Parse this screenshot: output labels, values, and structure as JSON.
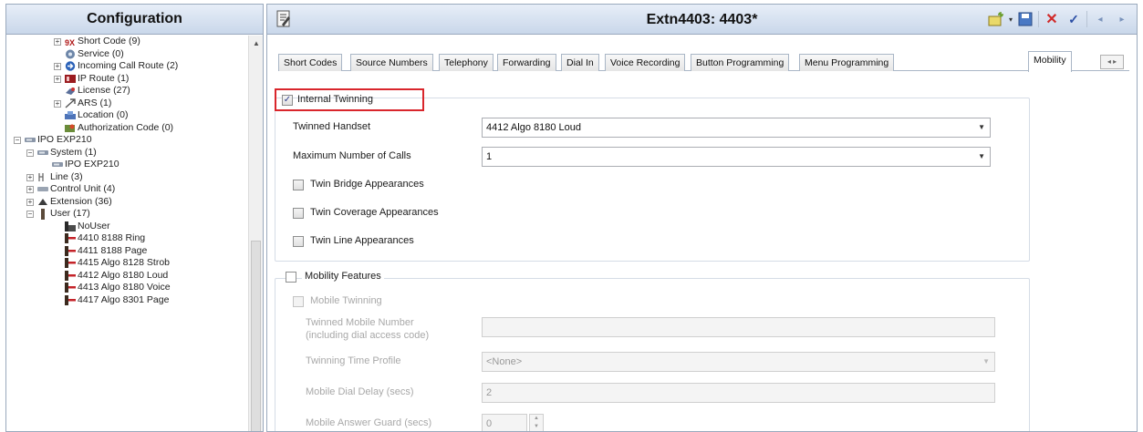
{
  "left_pane": {
    "title": "Configuration",
    "tree": [
      {
        "label": "Short Code (9)",
        "icon": "short-code-icon"
      },
      {
        "label": "Service (0)",
        "icon": "service-icon"
      },
      {
        "label": "Incoming Call Route (2)",
        "icon": "incoming-call-route-icon"
      },
      {
        "label": "IP Route (1)",
        "icon": "ip-route-icon"
      },
      {
        "label": "License (27)",
        "icon": "license-icon"
      },
      {
        "label": "ARS (1)",
        "icon": "ars-icon"
      },
      {
        "label": "Location (0)",
        "icon": "location-icon"
      },
      {
        "label": "Authorization Code (0)",
        "icon": "authorization-code-icon"
      },
      {
        "label": "IPO EXP210",
        "icon": "system-node-icon"
      },
      {
        "label": "System (1)",
        "icon": "system-icon"
      },
      {
        "label": "IPO EXP210",
        "icon": "system-node-icon"
      },
      {
        "label": "Line (3)",
        "icon": "line-icon"
      },
      {
        "label": "Control Unit (4)",
        "icon": "control-unit-icon"
      },
      {
        "label": "Extension (36)",
        "icon": "extension-icon"
      },
      {
        "label": "User (17)",
        "icon": "user-group-icon"
      },
      {
        "label": "NoUser",
        "icon": "nouser-icon"
      },
      {
        "label": "4410 8188 Ring",
        "icon": "user-icon"
      },
      {
        "label": "4411 8188 Page",
        "icon": "user-icon"
      },
      {
        "label": "4415 Algo 8128 Strob",
        "icon": "user-icon"
      },
      {
        "label": "4412 Algo 8180 Loud",
        "icon": "user-icon"
      },
      {
        "label": "4413 Algo 8180 Voice",
        "icon": "user-icon"
      },
      {
        "label": "4417 Algo 8301 Page",
        "icon": "user-icon"
      }
    ]
  },
  "right_pane": {
    "title": "Extn4403: 4403*",
    "toolbar": [
      "new-icon",
      "save-icon",
      "delete-icon",
      "ok-icon",
      "back-icon",
      "forward-icon"
    ],
    "tabs": [
      "Short Codes",
      "Source Numbers",
      "Telephony",
      "Forwarding",
      "Dial In",
      "Voice Recording",
      "Button Programming",
      "Menu Programming",
      "Mobility"
    ],
    "active_tab": "Mobility",
    "internal_twinning": {
      "label": "Internal Twinning",
      "checked": true,
      "twinned_handset_label": "Twinned Handset",
      "twinned_handset_value": "4412 Algo 8180 Loud",
      "max_calls_label": "Maximum Number of Calls",
      "max_calls_value": "1",
      "bridge_label": "Twin Bridge Appearances",
      "coverage_label": "Twin Coverage Appearances",
      "line_label": "Twin Line Appearances"
    },
    "mobility_features": {
      "label": "Mobility Features",
      "mobile_twinning_label": "Mobile Twinning",
      "twinned_mobile_number_label_1": "Twinned Mobile Number",
      "twinned_mobile_number_label_2": "(including dial access code)",
      "twinned_mobile_number_value": "",
      "time_profile_label": "Twinning Time Profile",
      "time_profile_value": "<None>",
      "dial_delay_label": "Mobile Dial Delay (secs)",
      "dial_delay_value": "2",
      "answer_guard_label": "Mobile Answer Guard (secs)",
      "answer_guard_value": "0"
    }
  },
  "colors": {
    "header_gradient_top": "#e7eef8",
    "header_gradient_bottom": "#c9d7ea",
    "highlight": "#d9262c"
  }
}
